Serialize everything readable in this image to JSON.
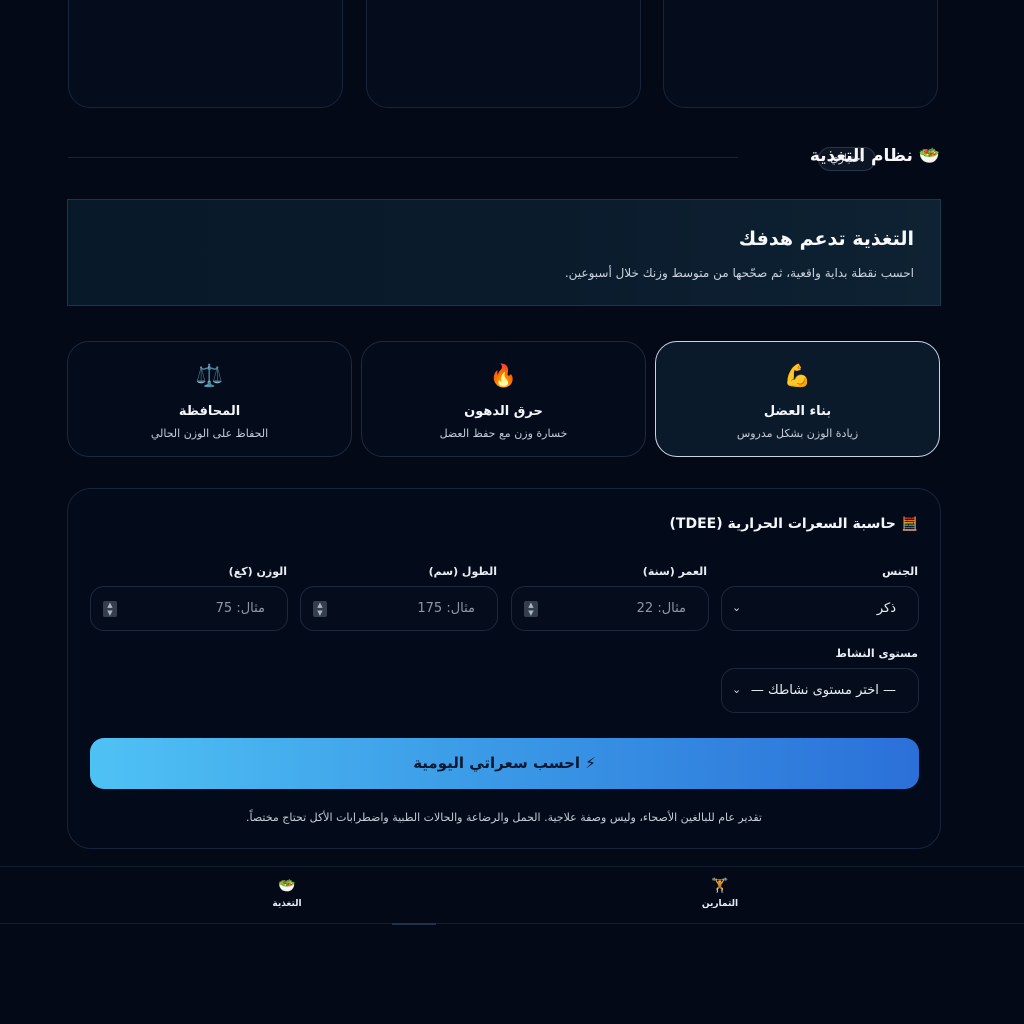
{
  "section": {
    "title": "نظام التغذية",
    "icon": "salad-bowl-icon",
    "badge": "اختياري"
  },
  "hero": {
    "title": "التغذية تدعم هدفك",
    "subtitle": "احسب نقطة بداية واقعية، ثم صحّحها من متوسط وزنك خلال أسبوعين."
  },
  "goals": [
    {
      "icon": "flexed-biceps-icon",
      "glyph": "💪",
      "title": "بناء العضل",
      "subtitle": "زيادة الوزن بشكل مدروس",
      "active": true
    },
    {
      "icon": "fire-icon",
      "glyph": "🔥",
      "title": "حرق الدهون",
      "subtitle": "خسارة وزن مع حفظ العضل",
      "active": false
    },
    {
      "icon": "balance-scale-icon",
      "glyph": "⚖️",
      "title": "المحافظة",
      "subtitle": "الحفاظ على الوزن الحالي",
      "active": false
    }
  ],
  "calculator": {
    "title": "حاسبة السعرات الحرارية (TDEE)",
    "icon": "abacus-icon",
    "fields": {
      "gender": {
        "label": "الجنس",
        "value": "ذكر"
      },
      "age": {
        "label": "العمر (سنة)",
        "placeholder": "مثال: 22"
      },
      "height": {
        "label": "الطول (سم)",
        "placeholder": "مثال: 175"
      },
      "weight": {
        "label": "الوزن (كغ)",
        "placeholder": "مثال: 75"
      },
      "activity": {
        "label": "مستوى النشاط",
        "value": "— اختر مستوى نشاطك —"
      }
    },
    "button_label": "⚡ احسب سعراتي اليومية",
    "note": "تقدير عام للبالغين الأصحاء، وليس وصفة علاجية. الحمل والرضاعة والحالات الطبية واضطرابات الأكل تحتاج مختصاً."
  },
  "nav": {
    "items": [
      {
        "label": "التمارين",
        "icon": "trophy-icon",
        "glyph": "🏋️"
      },
      {
        "label": "التغذية",
        "icon": "salad-bowl-icon",
        "glyph": "🥗"
      }
    ]
  }
}
